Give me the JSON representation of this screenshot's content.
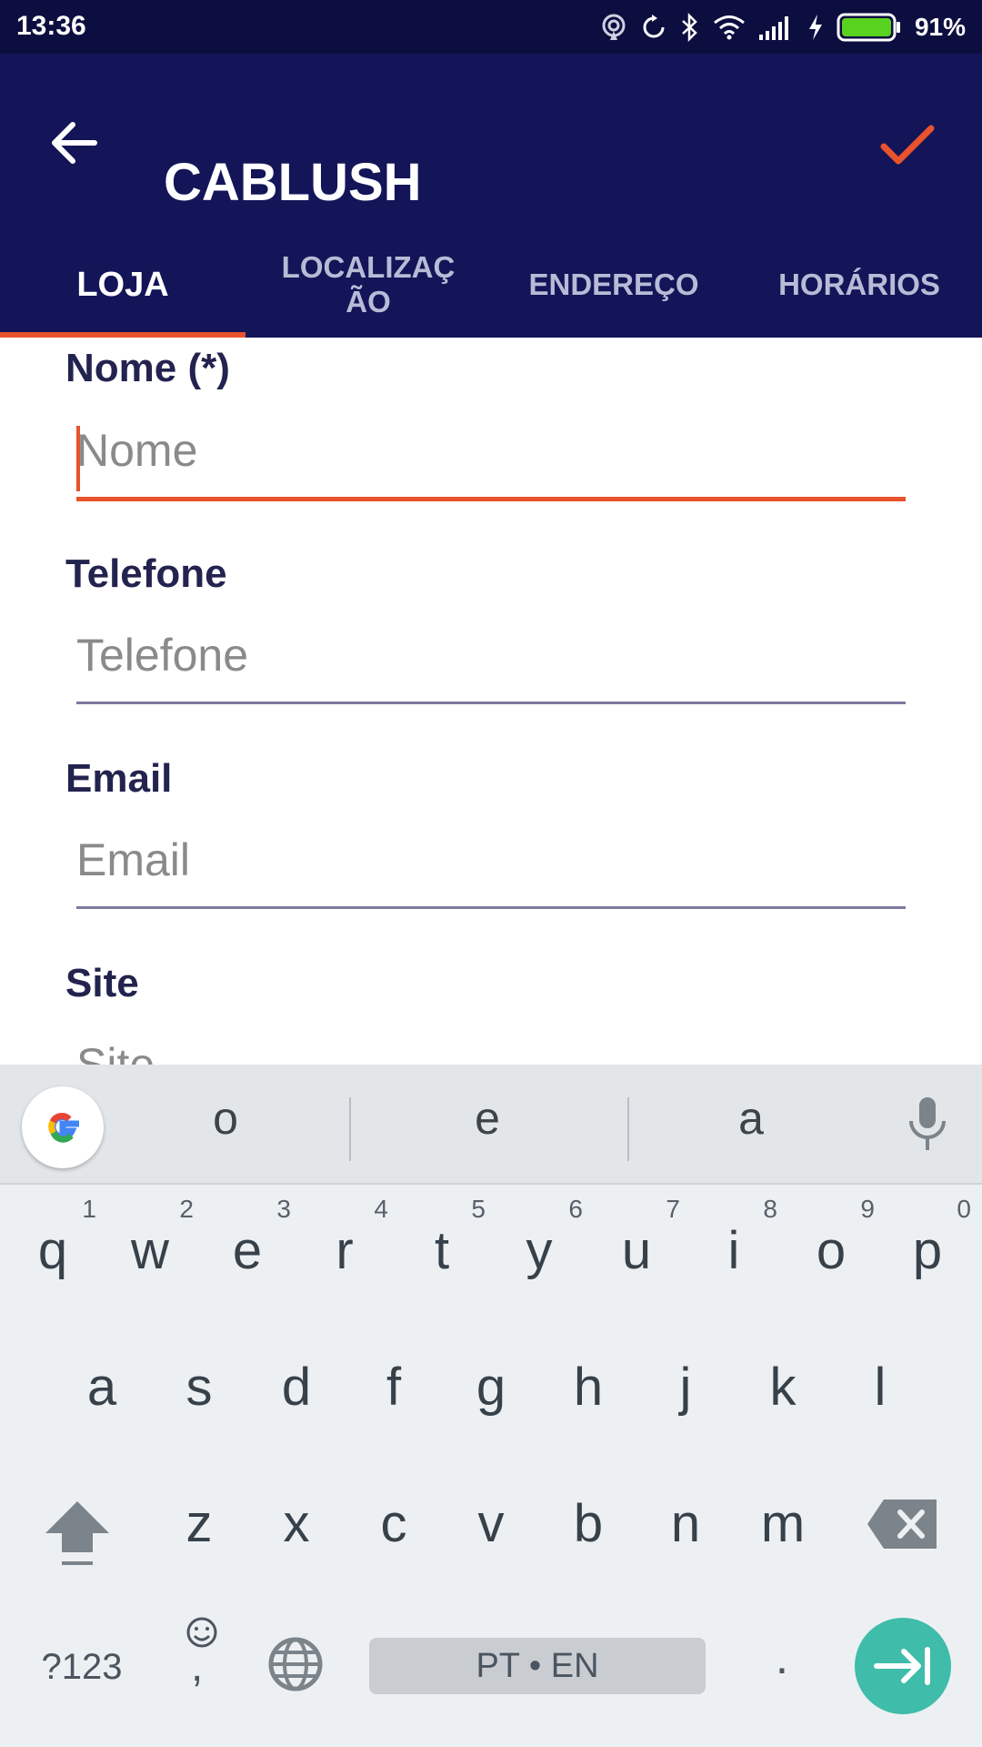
{
  "status_bar": {
    "time": "13:36",
    "battery": "91%"
  },
  "app_bar": {
    "title": "CABLUSH"
  },
  "tabs": [
    {
      "label": "LOJA",
      "active": true
    },
    {
      "label": "LOCALIZAÇ ÃO",
      "active": false
    },
    {
      "label": "ENDEREÇO",
      "active": false
    },
    {
      "label": "HORÁRIOS",
      "active": false
    }
  ],
  "form": {
    "fields": [
      {
        "label": "Nome (*)",
        "placeholder": "Nome",
        "value": ""
      },
      {
        "label": "Telefone",
        "placeholder": "Telefone",
        "value": ""
      },
      {
        "label": "Email",
        "placeholder": "Email",
        "value": ""
      },
      {
        "label": "Site",
        "placeholder": "Site",
        "value": ""
      }
    ]
  },
  "keyboard": {
    "suggestions": [
      "o",
      "e",
      "a"
    ],
    "row1": [
      {
        "key": "q",
        "hint": "1"
      },
      {
        "key": "w",
        "hint": "2"
      },
      {
        "key": "e",
        "hint": "3"
      },
      {
        "key": "r",
        "hint": "4"
      },
      {
        "key": "t",
        "hint": "5"
      },
      {
        "key": "y",
        "hint": "6"
      },
      {
        "key": "u",
        "hint": "7"
      },
      {
        "key": "i",
        "hint": "8"
      },
      {
        "key": "o",
        "hint": "9"
      },
      {
        "key": "p",
        "hint": "0"
      }
    ],
    "row2": [
      "a",
      "s",
      "d",
      "f",
      "g",
      "h",
      "j",
      "k",
      "l"
    ],
    "row3": [
      "z",
      "x",
      "c",
      "v",
      "b",
      "n",
      "m"
    ],
    "symbols_label": "?123",
    "comma_label": ",",
    "space_label": "PT • EN",
    "period_label": "."
  },
  "colors": {
    "status_bar": "#0d0e40",
    "app_bar": "#131558",
    "accent": "#e8522c",
    "label_text": "#23234f",
    "keyboard_bg": "#edf0f2",
    "enter_key": "#3fbcaa"
  }
}
